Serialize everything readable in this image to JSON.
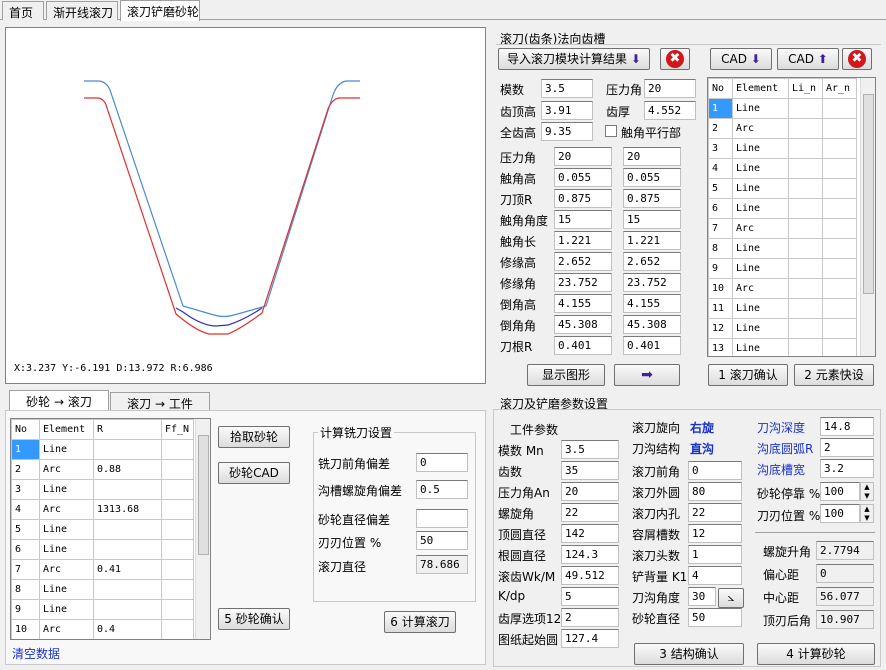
{
  "tabs": [
    "首页",
    "渐开线滚刀",
    "滚刀铲磨砂轮"
  ],
  "plot": {
    "status": "X:3.237  Y:-6.191  D:13.972  R:6.986"
  },
  "rack": {
    "title": "滚刀(齿条)法向齿槽",
    "import_btn": "导入滚刀模块计算结果",
    "cad_down": "CAD",
    "cad_up": "CAD",
    "module_label": "模数",
    "module": "3.5",
    "pa_label": "压力角",
    "pa": "20",
    "add_label": "齿顶高",
    "add": "3.91",
    "thick_label": "齿厚",
    "thick": "4.552",
    "whole_label": "全齿高",
    "whole": "9.35",
    "parallel_label": "触角平行部",
    "params": [
      {
        "label": "压力角",
        "a": "20",
        "b": "20"
      },
      {
        "label": "触角高",
        "a": "0.055",
        "b": "0.055"
      },
      {
        "label": "刀顶R",
        "a": "0.875",
        "b": "0.875"
      },
      {
        "label": "触角角度",
        "a": "15",
        "b": "15"
      },
      {
        "label": "触角长",
        "a": "1.221",
        "b": "1.221"
      },
      {
        "label": "修缘高",
        "a": "2.652",
        "b": "2.652"
      },
      {
        "label": "修缘角",
        "a": "23.752",
        "b": "23.752"
      },
      {
        "label": "倒角高",
        "a": "4.155",
        "b": "4.155"
      },
      {
        "label": "倒角角",
        "a": "45.308",
        "b": "45.308"
      },
      {
        "label": "刀根R",
        "a": "0.401",
        "b": "0.401"
      }
    ],
    "show_btn": "显示图形",
    "confirm_btn": "1 滚刀确认",
    "quick_btn": "2 元素快设",
    "table_headers": [
      "No",
      "Element",
      "Li_n",
      "Ar_n"
    ],
    "rows": [
      [
        "1",
        "Line"
      ],
      [
        "2",
        "Arc"
      ],
      [
        "3",
        "Line"
      ],
      [
        "4",
        "Line"
      ],
      [
        "5",
        "Line"
      ],
      [
        "6",
        "Line"
      ],
      [
        "7",
        "Arc"
      ],
      [
        "8",
        "Line"
      ],
      [
        "9",
        "Line"
      ],
      [
        "10",
        "Arc"
      ],
      [
        "11",
        "Line"
      ],
      [
        "12",
        "Line"
      ],
      [
        "13",
        "Line"
      ]
    ]
  },
  "wheel": {
    "tabs": [
      "砂轮 → 滚刀",
      "滚刀 → 工件"
    ],
    "table_headers": [
      "No",
      "Element",
      "R",
      "Ff_N"
    ],
    "rows": [
      [
        "1",
        "Line",
        ""
      ],
      [
        "2",
        "Arc",
        "0.88"
      ],
      [
        "3",
        "Line",
        ""
      ],
      [
        "4",
        "Arc",
        "1313.68"
      ],
      [
        "5",
        "Line",
        ""
      ],
      [
        "6",
        "Line",
        ""
      ],
      [
        "7",
        "Arc",
        "0.41"
      ],
      [
        "8",
        "Line",
        ""
      ],
      [
        "9",
        "Line",
        ""
      ],
      [
        "10",
        "Arc",
        "0.4"
      ]
    ],
    "pick_btn": "拾取砂轮",
    "cad_btn": "砂轮CAD",
    "confirm_btn": "5 砂轮确认",
    "clear_link": "清空数据",
    "settings_title": "计算铣刀设置",
    "rake_label": "铣刀前角偏差",
    "rake": "0",
    "helix_label": "沟槽螺旋角偏差",
    "helix": "0.5",
    "dia_label": "砂轮直径偏差",
    "dia": "",
    "edge_label": "刃刃位置 %",
    "edge": "50",
    "hob_dia_label": "滚刀直径",
    "hob_dia": "78.686",
    "calc_btn": "6 计算滚刀"
  },
  "params": {
    "title": "滚刀及铲磨参数设置",
    "work_title": "工件参数",
    "col1": [
      {
        "label": "模数 Mn",
        "value": "3.5"
      },
      {
        "label": "齿数",
        "value": "35"
      },
      {
        "label": "压力角An",
        "value": "20"
      },
      {
        "label": "螺旋角",
        "value": "22"
      },
      {
        "label": "顶圆直径",
        "value": "142"
      },
      {
        "label": "根圆直径",
        "value": "124.3"
      },
      {
        "label": "滚齿Wk/M",
        "value": "49.512"
      },
      {
        "label": "K/dp",
        "value": "5"
      },
      {
        "label": "齿厚选项123",
        "value": "2"
      },
      {
        "label": "图纸起始圆",
        "value": "127.4"
      }
    ],
    "dir_label": "滚刀旋向",
    "dir_value": "右旋",
    "groove_label": "刀沟结构",
    "groove_value": "直沟",
    "col2": [
      {
        "label": "滚刀前角",
        "value": "0"
      },
      {
        "label": "滚刀外圆",
        "value": "80"
      },
      {
        "label": "滚刀内孔",
        "value": "22"
      },
      {
        "label": "容屑槽数",
        "value": "12"
      },
      {
        "label": "滚刀头数",
        "value": "1"
      },
      {
        "label": "铲背量 K1",
        "value": "4"
      },
      {
        "label": "刀沟角度",
        "value": "30"
      },
      {
        "label": "砂轮直径",
        "value": "50"
      }
    ],
    "col3": [
      {
        "label": "刀沟深度",
        "value": "14.8"
      },
      {
        "label": "沟底圆弧R",
        "value": "2"
      },
      {
        "label": "沟底槽宽",
        "value": "3.2"
      }
    ],
    "stop_label": "砂轮停靠 %",
    "stop": "100",
    "edge_label": "刀刃位置 %",
    "edge": "100",
    "col4": [
      {
        "label": "螺旋升角",
        "value": "2.7794"
      },
      {
        "label": "偏心距",
        "value": "0"
      },
      {
        "label": "中心距",
        "value": "56.077"
      },
      {
        "label": "顶刃后角",
        "value": "10.907"
      }
    ],
    "struct_btn": "3 结构确认",
    "calc_btn": "4 计算砂轮"
  }
}
